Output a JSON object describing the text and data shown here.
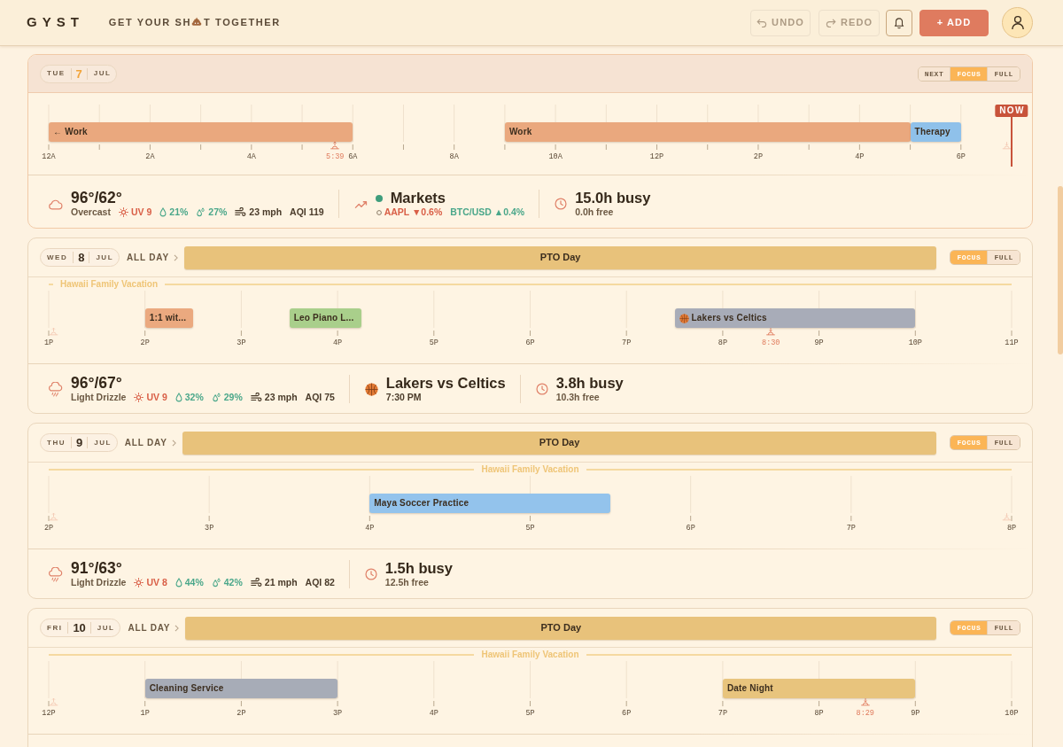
{
  "app": {
    "logo": "GYST",
    "tagline_start": "GET YOUR SH",
    "tagline_end": "T TOGETHER"
  },
  "toolbar": [
    {
      "kind": "undo",
      "label": "UNDO",
      "disabled": true
    },
    {
      "kind": "redo",
      "label": "REDO",
      "disabled": true
    },
    {
      "kind": "notifications",
      "disabled": false
    },
    {
      "kind": "add",
      "label": "+ ADD",
      "disabled": false
    },
    {
      "kind": "profile",
      "disabled": false
    }
  ],
  "days": [
    {
      "today": true,
      "weekday": "TUE",
      "date": "7",
      "month": "JUL",
      "views": [
        {
          "label": "NEXT",
          "selected": false
        },
        {
          "label": "FOCUS",
          "selected": true
        },
        {
          "label": "FULL",
          "selected": false
        }
      ],
      "timeline": {
        "ticks": [
          "12A",
          "2A",
          "4A",
          "6A",
          "8A",
          "10A",
          "12P",
          "2P",
          "4P",
          "6P"
        ],
        "events": [
          {
            "title": "← Work",
            "kind": "plain",
            "color": "#eaa87e"
          },
          {
            "title": "Work",
            "kind": "plain",
            "color": "#eaa87e"
          },
          {
            "title": "Therapy",
            "kind": "plain",
            "color": "#8fc1ea"
          }
        ],
        "sun": [
          {
            "kind": "sunrise",
            "faded": false,
            "label": "5:39"
          },
          {
            "kind": "sunset",
            "faded": true
          }
        ],
        "now": {
          "label": "NOW"
        }
      },
      "stats": [
        {
          "kind": "weather",
          "drizzle": false,
          "temps": "96°/62°",
          "condition": "Overcast",
          "uv": "UV 9",
          "humidity": "21%",
          "precipitation": "27%",
          "wind": "23 mph",
          "aqi": "AQI 119"
        },
        {
          "kind": "markets",
          "title": "Markets",
          "tickers": [
            {
              "text": "AAPL ▼0.6%",
              "rising": false
            },
            {
              "text": "BTC/USD ▲0.4%",
              "rising": true
            }
          ]
        },
        {
          "kind": "busy",
          "busy": "15.0h busy",
          "free": "0.0h free"
        }
      ]
    },
    {
      "today": false,
      "weekday": "WED",
      "date": "8",
      "month": "JUL",
      "all_day": {
        "label": "ALL DAY",
        "events": [
          {
            "title": "PTO Day",
            "color": "#e8c27b"
          }
        ]
      },
      "views": [
        {
          "label": "FOCUS",
          "selected": true
        },
        {
          "label": "FULL",
          "selected": false
        }
      ],
      "banner": {
        "title": "Hawaii Family Vacation",
        "starts_here": true
      },
      "timeline": {
        "ticks": [
          "1P",
          "2P",
          "3P",
          "4P",
          "5P",
          "6P",
          "7P",
          "8P",
          "9P",
          "10P",
          "11P"
        ],
        "events": [
          {
            "title": "1:1 wit...",
            "kind": "plain",
            "color": "#eba97f"
          },
          {
            "title": "Leo Piano L...",
            "kind": "plain",
            "color": "#a9cf8b"
          },
          {
            "title": "Lakers vs Celtics",
            "kind": "game",
            "color": "#a8acb8"
          }
        ],
        "sun": [
          {
            "kind": "sunrise",
            "faded": true
          },
          {
            "kind": "sunset",
            "faded": false,
            "label": "8:30"
          }
        ]
      },
      "stats": [
        {
          "kind": "weather",
          "drizzle": true,
          "temps": "96°/67°",
          "condition": "Light Drizzle",
          "uv": "UV 9",
          "humidity": "32%",
          "precipitation": "29%",
          "wind": "23 mph",
          "aqi": "AQI 75"
        },
        {
          "kind": "game",
          "title": "Lakers vs Celtics",
          "time": "7:30 PM"
        },
        {
          "kind": "busy",
          "busy": "3.8h busy",
          "free": "10.3h free"
        }
      ]
    },
    {
      "today": false,
      "weekday": "THU",
      "date": "9",
      "month": "JUL",
      "all_day": {
        "label": "ALL DAY",
        "events": [
          {
            "title": "PTO Day",
            "color": "#e8c27b"
          }
        ]
      },
      "views": [
        {
          "label": "FOCUS",
          "selected": true
        },
        {
          "label": "FULL",
          "selected": false
        }
      ],
      "banner": {
        "title": "Hawaii Family Vacation",
        "starts_here": false
      },
      "timeline": {
        "ticks": [
          "2P",
          "3P",
          "4P",
          "5P",
          "6P",
          "7P",
          "8P"
        ],
        "events": [
          {
            "title": "Maya Soccer Practice",
            "kind": "plain",
            "color": "#93c3ec"
          }
        ],
        "sun": [
          {
            "kind": "sunrise",
            "faded": true
          },
          {
            "kind": "sunset",
            "faded": true
          }
        ]
      },
      "stats": [
        {
          "kind": "weather",
          "drizzle": true,
          "temps": "91°/63°",
          "condition": "Light Drizzle",
          "uv": "UV 8",
          "humidity": "44%",
          "precipitation": "42%",
          "wind": "21 mph",
          "aqi": "AQI 82"
        },
        {
          "kind": "busy",
          "busy": "1.5h busy",
          "free": "12.5h free"
        }
      ]
    },
    {
      "today": false,
      "weekday": "FRI",
      "date": "10",
      "month": "JUL",
      "all_day": {
        "label": "ALL DAY",
        "events": [
          {
            "title": "PTO Day",
            "color": "#e8c27b"
          }
        ]
      },
      "views": [
        {
          "label": "FOCUS",
          "selected": true
        },
        {
          "label": "FULL",
          "selected": false
        }
      ],
      "banner": {
        "title": "Hawaii Family Vacation",
        "starts_here": false
      },
      "timeline": {
        "ticks": [
          "12P",
          "1P",
          "2P",
          "3P",
          "4P",
          "5P",
          "6P",
          "7P",
          "8P",
          "9P",
          "10P"
        ],
        "events": [
          {
            "title": "Cleaning Service",
            "kind": "plain",
            "color": "#a7acb7"
          },
          {
            "title": "Date Night",
            "kind": "plain",
            "color": "#e8c47d"
          }
        ],
        "sun": [
          {
            "kind": "sunrise",
            "faded": true
          },
          {
            "kind": "sunset",
            "faded": false,
            "label": "8:29"
          }
        ]
      }
    }
  ]
}
